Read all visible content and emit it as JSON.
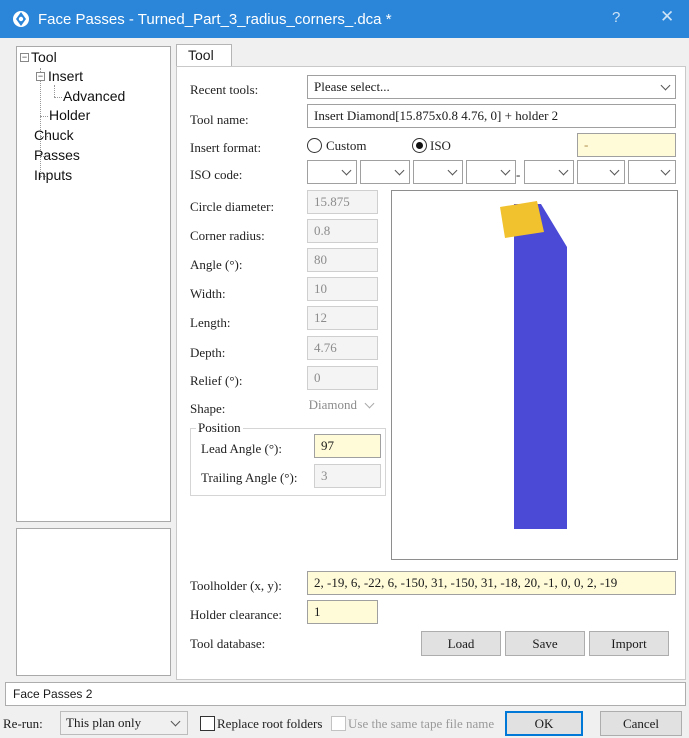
{
  "window": {
    "title": "Face Passes - Turned_Part_3_radius_corners_.dca *",
    "help_glyph": "?",
    "close_glyph": "✕"
  },
  "tree": {
    "items": [
      {
        "label": "Tool"
      },
      {
        "label": "Insert"
      },
      {
        "label": "Advanced"
      },
      {
        "label": "Holder"
      },
      {
        "label": "Chuck"
      },
      {
        "label": "Passes"
      },
      {
        "label": "Inputs"
      }
    ]
  },
  "tab": {
    "label": "Tool"
  },
  "form": {
    "recent_tools": {
      "label": "Recent tools:",
      "value": "Please select..."
    },
    "tool_name": {
      "label": "Tool name:",
      "value": "Insert Diamond[15.875x0.8 4.76, 0] + holder 2"
    },
    "insert_format": {
      "label": "Insert format:",
      "custom_label": "Custom",
      "iso_label": "ISO",
      "selected": "ISO",
      "iso_value": "-"
    },
    "iso_code": {
      "label": "ISO code:",
      "separator": "-"
    },
    "circle_diameter": {
      "label": "Circle diameter:",
      "value": "15.875"
    },
    "corner_radius": {
      "label": "Corner radius:",
      "value": "0.8"
    },
    "angle": {
      "label": "Angle (°):",
      "value": "80"
    },
    "width": {
      "label": "Width:",
      "value": "10"
    },
    "length": {
      "label": "Length:",
      "value": "12"
    },
    "depth": {
      "label": "Depth:",
      "value": "4.76"
    },
    "relief": {
      "label": "Relief (°):",
      "value": "0"
    },
    "shape": {
      "label": "Shape:",
      "value": "Diamond"
    },
    "position": {
      "title": "Position",
      "lead_angle": {
        "label": "Lead Angle (°):",
        "value": "97"
      },
      "trailing_angle": {
        "label": "Trailing Angle (°):",
        "value": "3"
      }
    },
    "toolholder": {
      "label": "Toolholder (x, y):",
      "value": "2, -19, 6, -22, 6, -150, 31, -150, 31, -18, 20, -1, 0, 0, 2, -19"
    },
    "holder_clearance": {
      "label": "Holder clearance:",
      "value": "1"
    },
    "tool_database": {
      "label": "Tool database:",
      "load": "Load",
      "save": "Save",
      "import": "Import"
    }
  },
  "preview": {
    "insert_color": "#f2c12e",
    "holder_color": "#4a4ad6"
  },
  "footer": {
    "name_value": "Face Passes 2",
    "rerun_label": "Re-run:",
    "rerun_value": "This plan only",
    "replace_root": "Replace root folders",
    "same_tape": "Use the same tape file name",
    "ok": "OK",
    "cancel": "Cancel"
  }
}
